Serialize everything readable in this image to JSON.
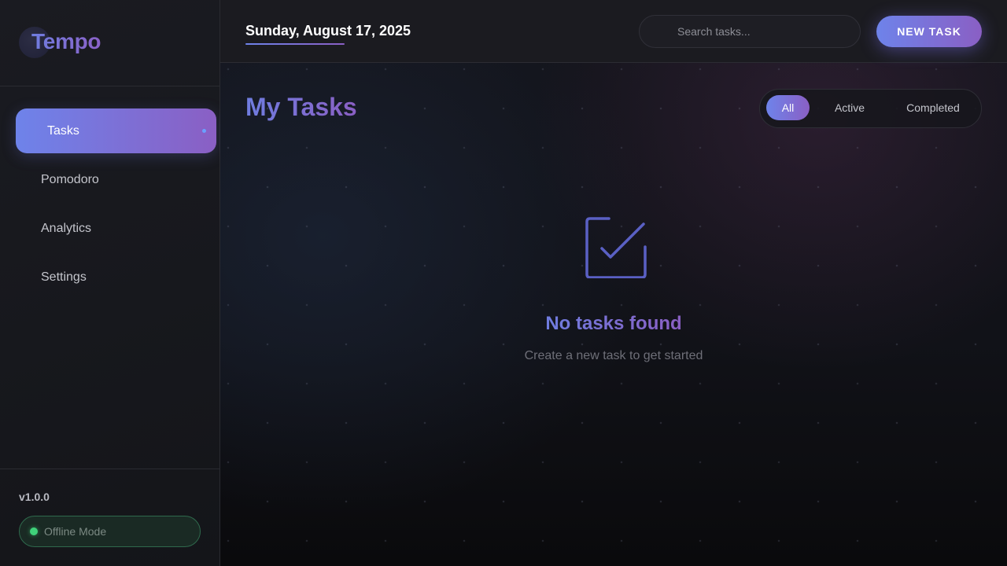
{
  "app": {
    "name": "Tempo",
    "version": "v1.0.0",
    "status": "Offline Mode"
  },
  "sidebar": {
    "items": [
      {
        "label": "Tasks",
        "active": true
      },
      {
        "label": "Pomodoro",
        "active": false
      },
      {
        "label": "Analytics",
        "active": false
      },
      {
        "label": "Settings",
        "active": false
      }
    ]
  },
  "header": {
    "date": "Sunday, August 17, 2025",
    "search_placeholder": "Search tasks...",
    "search_value": "",
    "new_task_label": "NEW TASK"
  },
  "main": {
    "title": "My Tasks",
    "filters": [
      {
        "label": "All",
        "active": true
      },
      {
        "label": "Active",
        "active": false
      },
      {
        "label": "Completed",
        "active": false
      }
    ],
    "empty_state": {
      "icon": "checkbox-icon",
      "title": "No tasks found",
      "subtitle": "Create a new task to get started"
    }
  },
  "colors": {
    "accent_start": "#6e83ea",
    "accent_end": "#8a5fc4",
    "status_online": "#3fd27a"
  }
}
